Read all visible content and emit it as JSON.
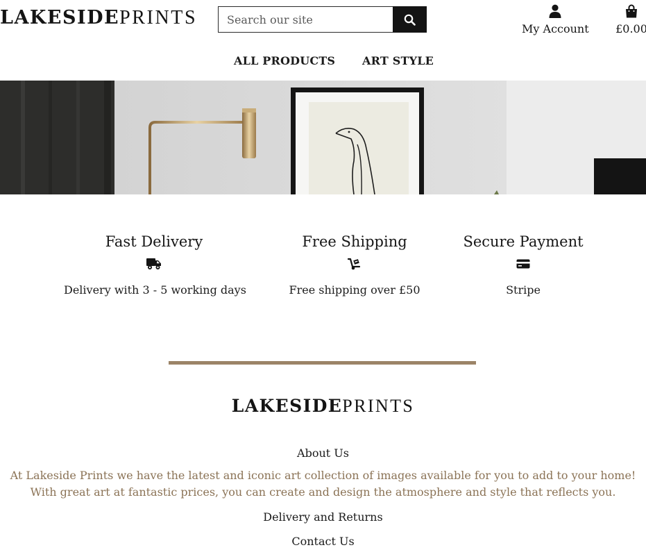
{
  "header": {
    "logo_bold": "LAKESIDE",
    "logo_light": "PRINTS",
    "search": {
      "placeholder": "Search our site",
      "icon": "search-icon"
    },
    "account_label": "My Account",
    "account_icon": "user-icon",
    "cart_label": "£0.00",
    "cart_icon": "shopping-bag-icon"
  },
  "nav": {
    "items": [
      {
        "label": "ALL PRODUCTS"
      },
      {
        "label": "ART STYLE"
      }
    ]
  },
  "hero": {
    "image": "living room wall with brass lamp and framed penguin line drawing"
  },
  "features": [
    {
      "title": "Fast Delivery",
      "icon": "truck-icon",
      "text": "Delivery with 3 - 5 working days"
    },
    {
      "title": "Free Shipping",
      "icon": "hand-truck-icon",
      "text": "Free shipping over £50"
    },
    {
      "title": "Secure Payment",
      "icon": "credit-card-icon",
      "text": "Stripe"
    }
  ],
  "footer": {
    "logo_bold": "LAKESIDE",
    "logo_light": "PRINTS",
    "about_label": "About Us",
    "about_text": "At Lakeside Prints we have the latest and iconic art collection of images available for you to add to your home! With great art at fantastic prices, you can create and design the atmosphere and style that reflects you.",
    "delivery_label": "Delivery and Returns",
    "contact_label": "Contact Us"
  },
  "colors": {
    "accent": "#9c8467",
    "about_text": "#8b7356",
    "dark": "#141414"
  }
}
